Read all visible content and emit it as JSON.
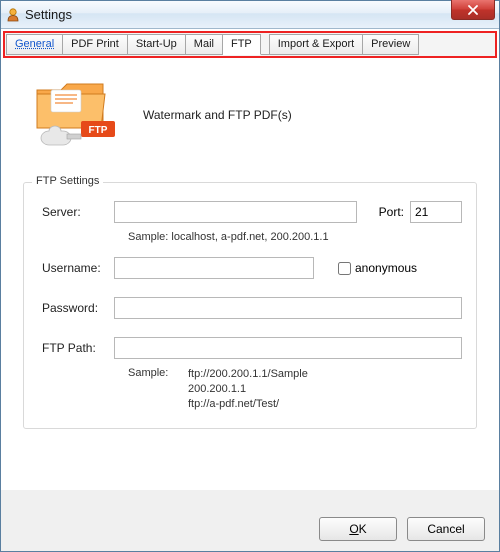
{
  "window": {
    "title": "Settings"
  },
  "tabs": [
    {
      "label": "General"
    },
    {
      "label": "PDF Print"
    },
    {
      "label": "Start-Up"
    },
    {
      "label": "Mail"
    },
    {
      "label": "FTP"
    },
    {
      "label": "Import & Export"
    },
    {
      "label": "Preview"
    }
  ],
  "hero": {
    "text": "Watermark and FTP PDF(s)"
  },
  "ftp": {
    "legend": "FTP Settings",
    "server_label": "Server:",
    "server_value": "",
    "port_label": "Port:",
    "port_value": "21",
    "server_sample": "Sample: localhost, a-pdf.net, 200.200.1.1",
    "username_label": "Username:",
    "username_value": "",
    "anonymous_label": "anonymous",
    "password_label": "Password:",
    "password_value": "",
    "ftppath_label": "FTP Path:",
    "ftppath_value": "",
    "path_sample_label": "Sample:",
    "path_sample_text": "ftp://200.200.1.1/Sample\n200.200.1.1\nftp://a-pdf.net/Test/"
  },
  "buttons": {
    "ok": "OK",
    "cancel": "Cancel"
  }
}
